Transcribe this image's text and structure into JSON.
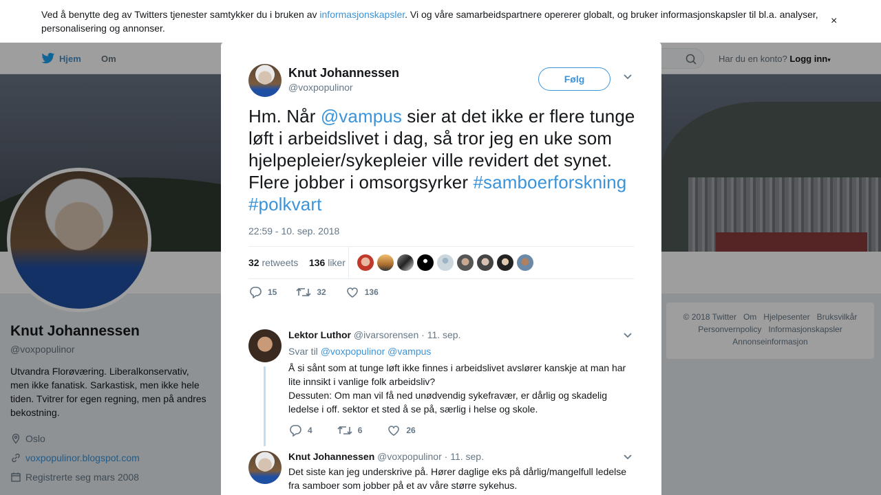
{
  "cookie": {
    "text_before": "Ved å benytte deg av Twitters tjenester samtykker du i bruken av ",
    "link": "informasjonskapsler",
    "text_after": ". Vi og våre samarbeidspartnere opererer globalt, og bruker informasjonskapsler til bl.a. analyser, personalisering og annonser.",
    "close": "×"
  },
  "overlay_close": "✕",
  "nav": {
    "home": "Hjem",
    "about": "Om",
    "login_prompt": "Har du en konto?",
    "login": "Logg inn"
  },
  "profile": {
    "name": "Knut Johannessen",
    "handle": "@voxpopulinor",
    "bio": "Utvandra Florøværing. Liberalkonservativ, men ikke fanatisk. Sarkastisk, men ikke hele tiden. Tvitrer for egen regning, men på andres bekostning.",
    "location": "Oslo",
    "website": "voxpopulinor.blogspot.com",
    "joined": "Registrerte seg mars 2008"
  },
  "footer": [
    "© 2018 Twitter",
    "Om",
    "Hjelpesenter",
    "Bruksvilkår",
    "Personvernpolicy",
    "Informasjonskapsler",
    "Annonseinformasjon"
  ],
  "tweet": {
    "name": "Knut Johannessen",
    "handle": "@voxpopulinor",
    "follow": "Følg",
    "text_1": "Hm. Når ",
    "mention": "@vampus",
    "text_2": " sier at det ikke er flere tunge løft i arbeidslivet i dag, så tror jeg en uke som hjelpepleier/sykepleier ville revidert det synet. Flere jobber i omsorgsyrker ",
    "hashtag_1": "#samboerforskning",
    "hashtag_2": "#polkvart",
    "timestamp": "22:59 - 10. sep. 2018",
    "retweets_count": "32",
    "retweets_label": "retweets",
    "likes_count": "136",
    "likes_label": "liker",
    "replies": "15",
    "rt": "32",
    "likes": "136"
  },
  "replies": [
    {
      "name": "Lektor Luthor",
      "handle": "@ivarsorensen",
      "date": "· 11. sep.",
      "reply_to_label": "Svar til",
      "reply_to": "@voxpopulinor @vampus",
      "text_1": "Å si sånt som at tunge løft ikke finnes i arbeidslivet avslører kanskje at man har lite innsikt i vanlige folk arbeidsliv?",
      "text_2": "Dessuten: Om man vil få ned unødvendig sykefravær, er dårlig og skadelig ledelse i off. sektor et sted å se på, særlig i helse og skole.",
      "replies": "4",
      "rt": "6",
      "likes": "26"
    },
    {
      "name": "Knut Johannessen",
      "handle": "@voxpopulinor",
      "date": "· 11. sep.",
      "text_1": "Det siste kan jeg underskrive på. Hører daglige eks på dårlig/mangelfull ledelse fra samboer som jobber på et av våre større sykehus."
    }
  ],
  "colors": {
    "accent": "#3b94d9",
    "overlay": "rgba(0,0,0,0.38)"
  }
}
